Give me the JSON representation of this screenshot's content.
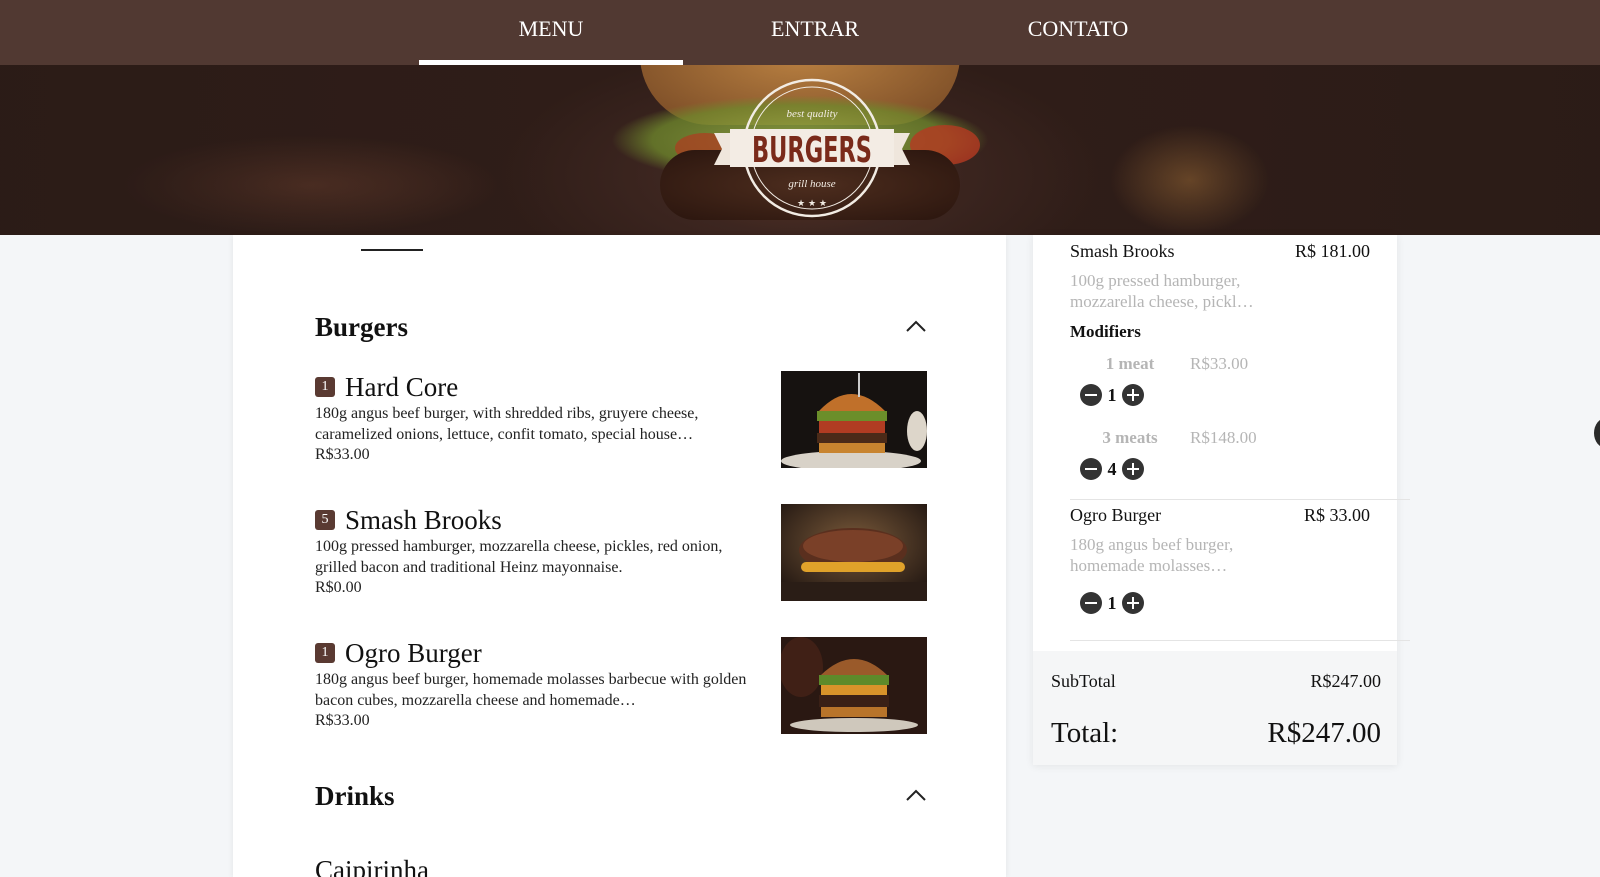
{
  "nav": {
    "items": [
      {
        "label": "MENU",
        "active": true
      },
      {
        "label": "ENTRAR",
        "active": false
      },
      {
        "label": "CONTATO",
        "active": false
      }
    ]
  },
  "hero": {
    "logo_title": "BURGERS",
    "logo_top_text": "best quality",
    "logo_bottom_text": "grill house",
    "logo_stars": "★ ★ ★"
  },
  "menu": {
    "sections": [
      {
        "title": "Burgers",
        "expanded": true,
        "items": [
          {
            "qty": "1",
            "name": "Hard Core",
            "description": "180g angus beef burger, with shredded ribs, gruyere cheese, caramelized onions, lettuce, confit tomato, special house…",
            "price": "R$33.00",
            "image": "burger-photo"
          },
          {
            "qty": "5",
            "name": "Smash Brooks",
            "description": "100g pressed hamburger, mozzarella cheese, pickles, red onion, grilled bacon and traditional Heinz mayonnaise.",
            "price": "R$0.00",
            "image": "patty-photo"
          },
          {
            "qty": "1",
            "name": "Ogro Burger",
            "description": "180g angus beef burger, homemade molasses barbecue with golden bacon cubes, mozzarella cheese and homemade…",
            "price": "R$33.00",
            "image": "burger-photo"
          }
        ]
      },
      {
        "title": "Drinks",
        "expanded": true,
        "items": [
          {
            "name": "Caipirinha"
          }
        ]
      }
    ]
  },
  "cart": {
    "items": [
      {
        "name": "Smash Brooks",
        "price": "R$ 181.00",
        "description": "100g pressed hamburger, mozzarella cheese, pickl…",
        "modifiers_title": "Modifiers",
        "modifiers": [
          {
            "name": "1 meat",
            "price": "R$33.00",
            "qty": "1"
          },
          {
            "name": "3 meats",
            "price": "R$148.00",
            "qty": "4"
          }
        ]
      },
      {
        "name": "Ogro Burger",
        "price": "R$ 33.00",
        "description": "180g angus beef burger, homemade molasses…",
        "qty": "1"
      }
    ],
    "subtotal_label": "SubTotal",
    "subtotal_value": "R$247.00",
    "total_label": "Total:",
    "total_value": "R$247.00"
  },
  "colors": {
    "nav_bg": "#513932",
    "badge_bg": "#5a3a32",
    "muted_text": "#b5b5b5"
  }
}
